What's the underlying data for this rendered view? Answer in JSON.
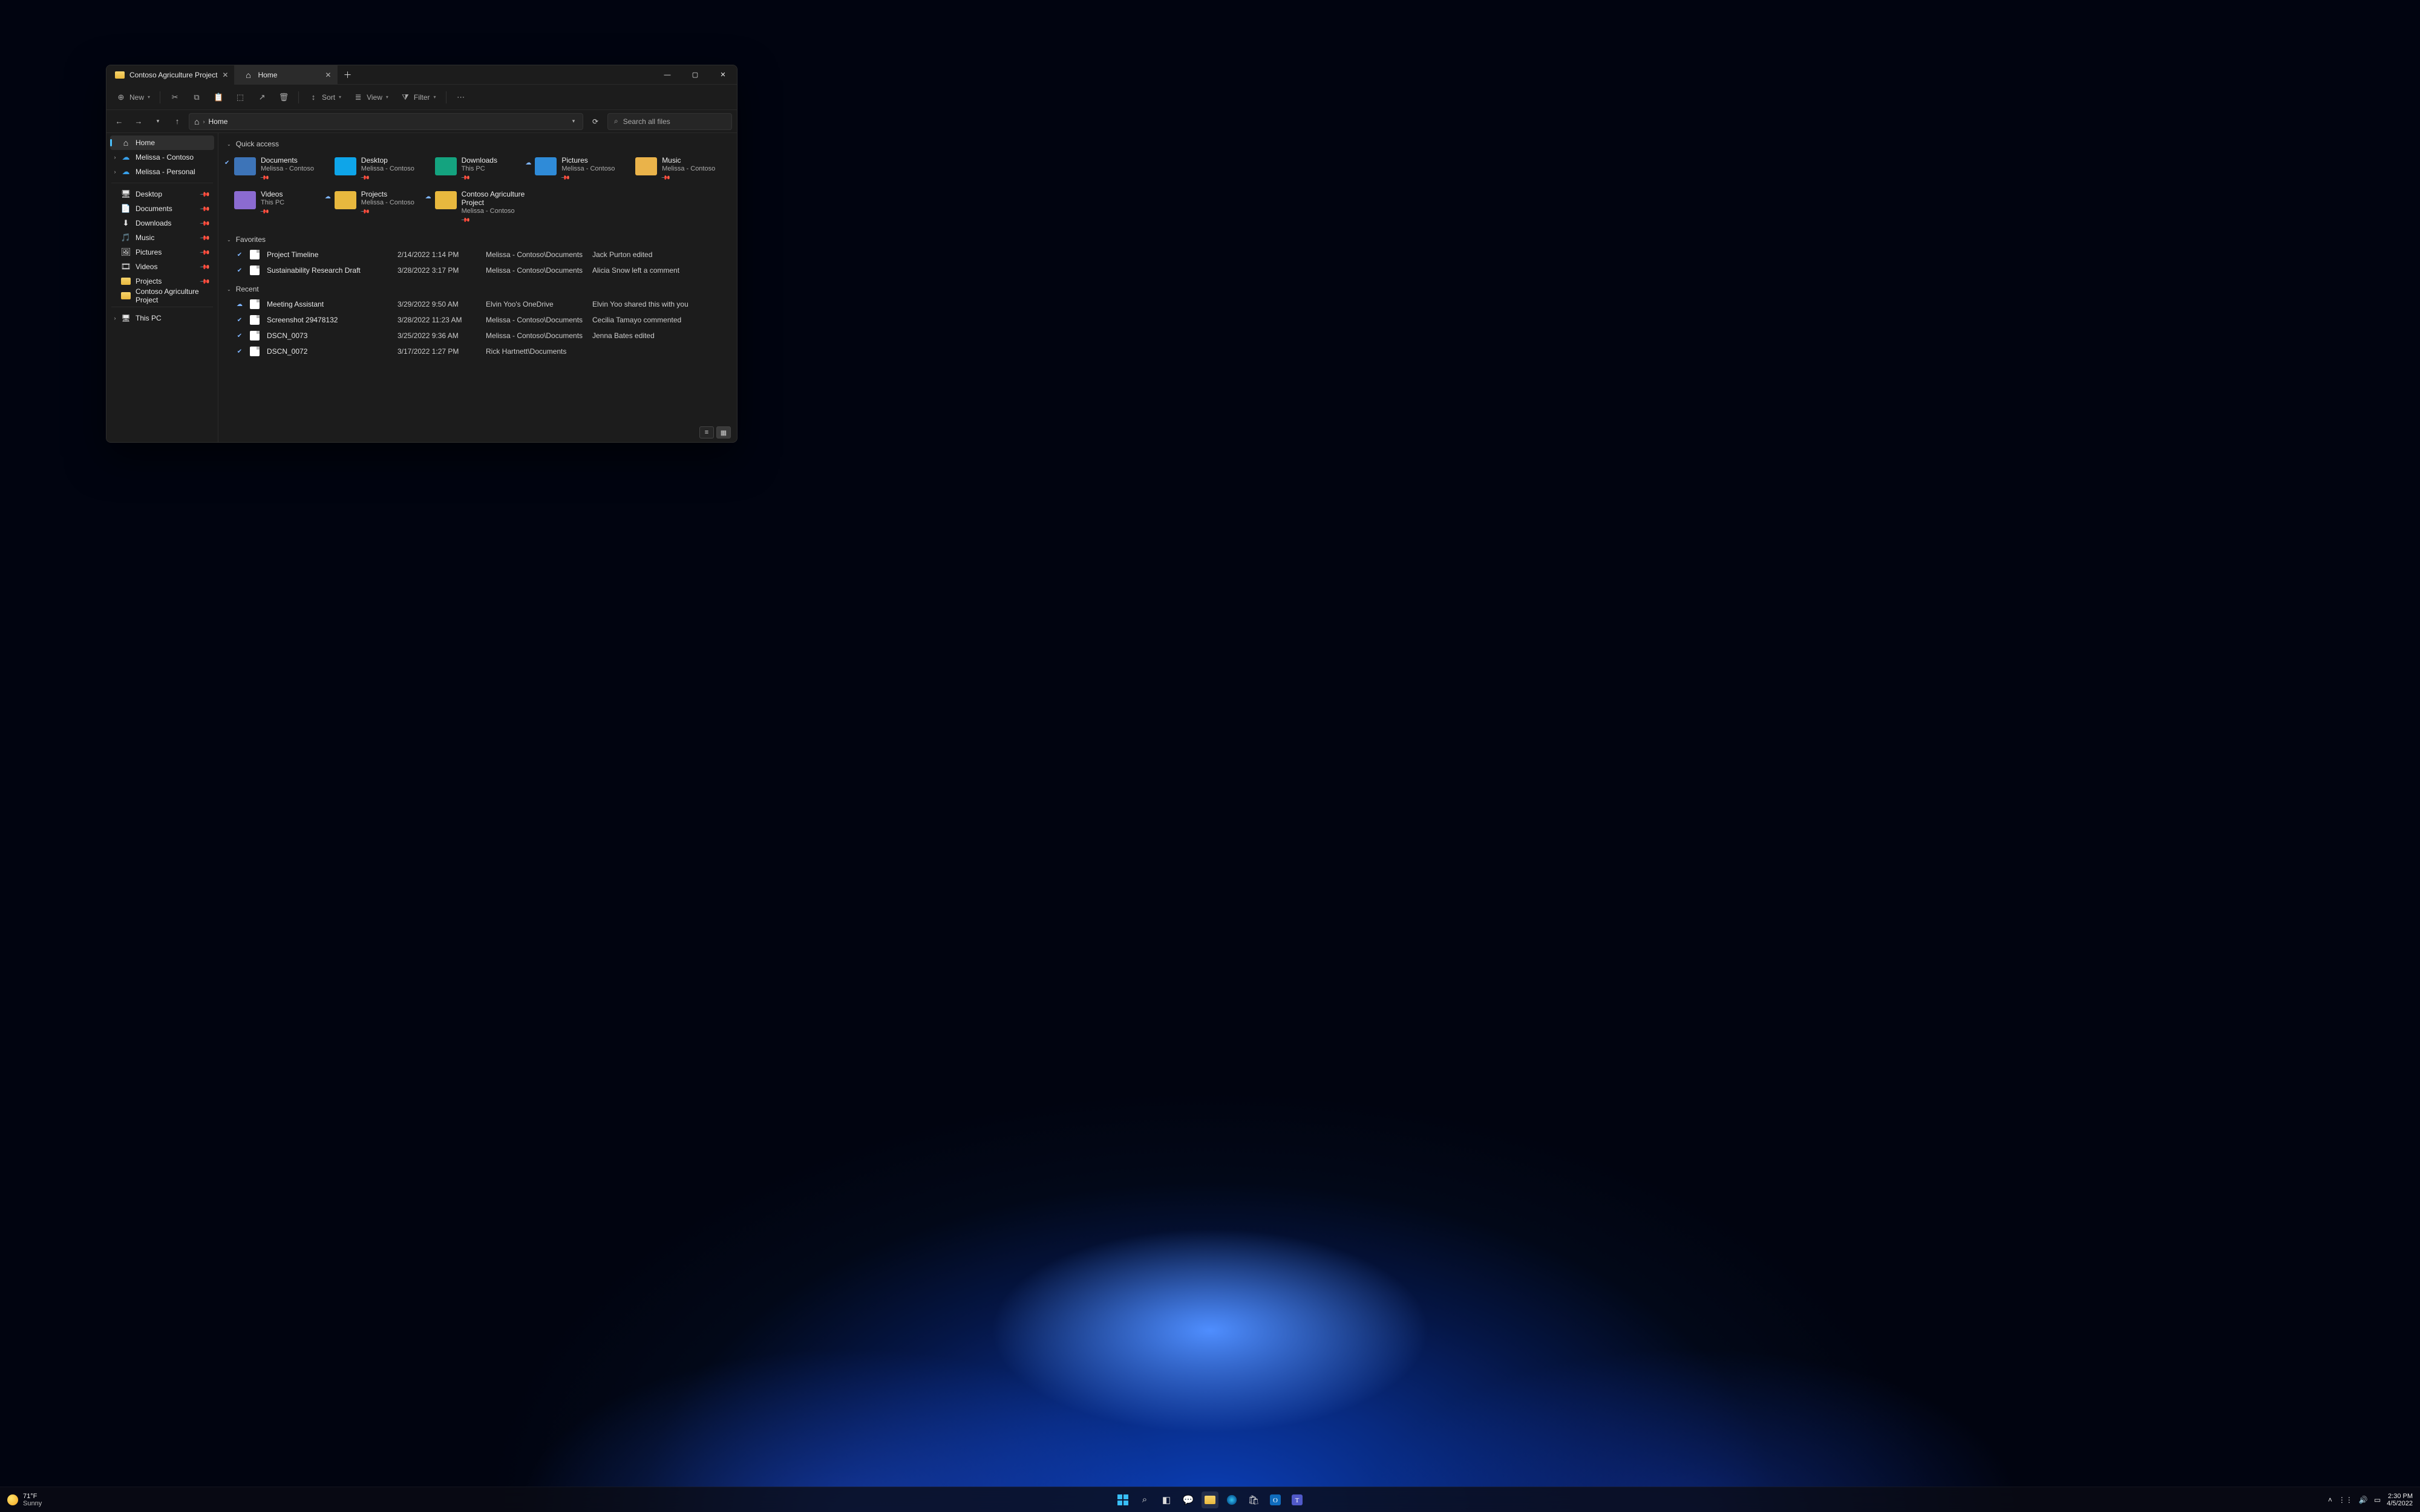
{
  "window": {
    "tabs": [
      {
        "label": "Contoso Agriculture Project",
        "active": false
      },
      {
        "label": "Home",
        "active": true
      }
    ]
  },
  "toolbar": {
    "new_label": "New",
    "sort_label": "Sort",
    "view_label": "View",
    "filter_label": "Filter"
  },
  "address": {
    "crumb": "Home",
    "search_placeholder": "Search all files"
  },
  "nav": {
    "home": "Home",
    "cloud": [
      {
        "label": "Melissa - Contoso"
      },
      {
        "label": "Melissa - Personal"
      }
    ],
    "pinned": [
      {
        "label": "Desktop"
      },
      {
        "label": "Documents"
      },
      {
        "label": "Downloads"
      },
      {
        "label": "Music"
      },
      {
        "label": "Pictures"
      },
      {
        "label": "Videos"
      },
      {
        "label": "Projects"
      },
      {
        "label": "Contoso Agriculture Project"
      }
    ],
    "thispc": "This PC"
  },
  "sections": {
    "quick_access": "Quick access",
    "favorites": "Favorites",
    "recent": "Recent"
  },
  "quick_access": [
    {
      "name": "Documents",
      "sub": "Melissa - Contoso",
      "color": "#3d74b8",
      "sync": "✔"
    },
    {
      "name": "Desktop",
      "sub": "Melissa - Contoso",
      "color": "#0ea5e9",
      "sync": ""
    },
    {
      "name": "Downloads",
      "sub": "This PC",
      "color": "#14a37f",
      "sync": ""
    },
    {
      "name": "Pictures",
      "sub": "Melissa - Contoso",
      "color": "#2f8bd8",
      "sync": "☁"
    },
    {
      "name": "Music",
      "sub": "Melissa - Contoso",
      "color": "#eab34a",
      "sync": ""
    },
    {
      "name": "Videos",
      "sub": "This PC",
      "color": "#8b6bd1",
      "sync": ""
    },
    {
      "name": "Projects",
      "sub": "Melissa - Contoso",
      "color": "#e8b83e",
      "sync": "☁"
    },
    {
      "name": "Contoso Agriculture Project",
      "sub": "Melissa - Contoso",
      "color": "#e8b83e",
      "sync": "☁"
    }
  ],
  "favorites": [
    {
      "sync": "✔",
      "name": "Project Timeline",
      "date": "2/14/2022 1:14 PM",
      "loc": "Melissa - Contoso\\Documents",
      "act": "Jack Purton edited"
    },
    {
      "sync": "✔",
      "name": "Sustainability Research Draft",
      "date": "3/28/2022 3:17 PM",
      "loc": "Melissa - Contoso\\Documents",
      "act": "Alicia Snow left a comment"
    }
  ],
  "recent": [
    {
      "sync": "☁",
      "name": "Meeting Assistant",
      "date": "3/29/2022 9:50 AM",
      "loc": "Elvin Yoo's OneDrive",
      "act": "Elvin Yoo shared this with you"
    },
    {
      "sync": "✔",
      "name": "Screenshot 29478132",
      "date": "3/28/2022 11:23 AM",
      "loc": "Melissa - Contoso\\Documents",
      "act": "Cecilia Tamayo commented"
    },
    {
      "sync": "✔",
      "name": "DSCN_0073",
      "date": "3/25/2022 9:36 AM",
      "loc": "Melissa - Contoso\\Documents",
      "act": "Jenna Bates edited"
    },
    {
      "sync": "✔",
      "name": "DSCN_0072",
      "date": "3/17/2022 1:27 PM",
      "loc": "Rick Hartnett\\Documents",
      "act": ""
    }
  ],
  "taskbar": {
    "weather_temp": "71°F",
    "weather_desc": "Sunny",
    "time": "2:30 PM",
    "date": "4/5/2022"
  }
}
